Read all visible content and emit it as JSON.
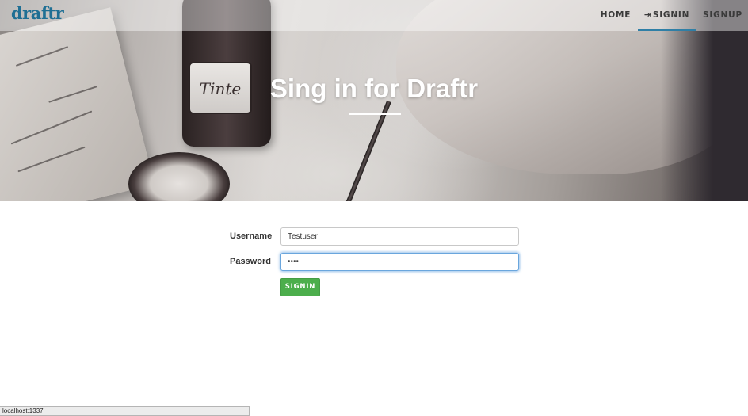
{
  "brand": {
    "name": "draftr",
    "color": "#1f6f94"
  },
  "nav": {
    "items": [
      {
        "label": "HOME"
      },
      {
        "label": "SIGNIN",
        "icon": "signin-icon",
        "active": true
      },
      {
        "label": "SIGNUP"
      }
    ],
    "active_underline_color": "#2f7fa6"
  },
  "hero": {
    "title": "Sing in for Draftr",
    "image_ink_label": "Tinte"
  },
  "form": {
    "username_label": "Username",
    "username_value": "Testuser",
    "password_label": "Password",
    "password_value": "••••",
    "submit_label": "SIGNIN",
    "submit_color": "#4cae4c"
  },
  "status_bar": {
    "text": "localhost:1337"
  }
}
